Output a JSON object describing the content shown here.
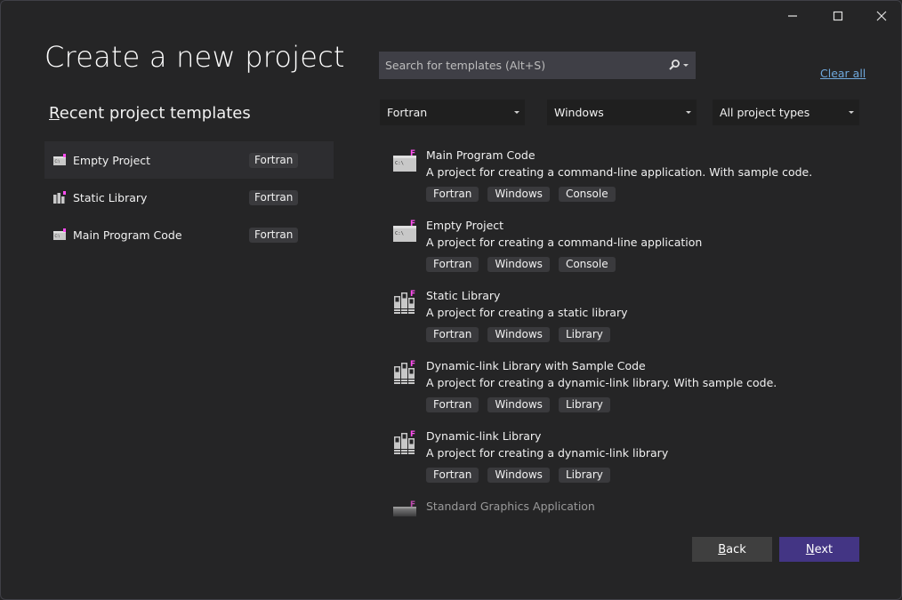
{
  "window": {
    "controls": {
      "minimize": "minimize",
      "maximize": "maximize",
      "close": "close"
    }
  },
  "title": "Create a new project",
  "recent": {
    "heading_access_key": "R",
    "heading_rest": "ecent project templates",
    "items": [
      {
        "name": "Empty Project",
        "tag": "Fortran",
        "icon": "console-app-icon",
        "selected": true
      },
      {
        "name": "Static Library",
        "tag": "Fortran",
        "icon": "library-icon",
        "selected": false
      },
      {
        "name": "Main Program Code",
        "tag": "Fortran",
        "icon": "console-app-icon",
        "selected": false
      }
    ]
  },
  "search": {
    "placeholder": "Search for templates (Alt+S)",
    "value": ""
  },
  "clear_all": "Clear all",
  "filters": {
    "language": "Fortran",
    "platform": "Windows",
    "project_type": "All project types"
  },
  "templates": [
    {
      "name": "Main Program Code",
      "description": "A project for creating a command-line application. With sample code.",
      "tags": [
        "Fortran",
        "Windows",
        "Console"
      ],
      "icon": "console-app-icon"
    },
    {
      "name": "Empty Project",
      "description": "A project for creating a command-line application",
      "tags": [
        "Fortran",
        "Windows",
        "Console"
      ],
      "icon": "console-app-icon"
    },
    {
      "name": "Static Library",
      "description": "A project for creating a static library",
      "tags": [
        "Fortran",
        "Windows",
        "Library"
      ],
      "icon": "library-icon"
    },
    {
      "name": "Dynamic-link Library with Sample Code",
      "description": "A project for creating a dynamic-link library. With sample code.",
      "tags": [
        "Fortran",
        "Windows",
        "Library"
      ],
      "icon": "library-icon"
    },
    {
      "name": "Dynamic-link Library",
      "description": "A project for creating a dynamic-link library",
      "tags": [
        "Fortran",
        "Windows",
        "Library"
      ],
      "icon": "library-icon"
    },
    {
      "name": "Standard Graphics Application",
      "description": "",
      "tags": [],
      "icon": "graphics-app-icon"
    }
  ],
  "buttons": {
    "back_key": "B",
    "back_rest": "ack",
    "next_key": "N",
    "next_rest": "ext"
  },
  "colors": {
    "accent": "#433584",
    "fortran_badge": "#ff4df0",
    "link": "#6fa8dc"
  }
}
